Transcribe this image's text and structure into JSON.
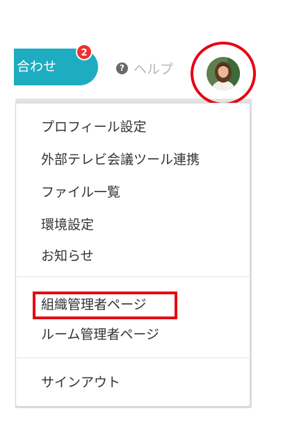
{
  "header": {
    "inquiry_label": "合わせ",
    "inquiry_badge_count": "2",
    "help_label": "ヘルプ",
    "help_icon": "question-circle-icon"
  },
  "user_menu": {
    "group1": [
      {
        "label": "プロフィール設定"
      },
      {
        "label": "外部テレビ会議ツール連携"
      },
      {
        "label": "ファイル一覧"
      },
      {
        "label": "環境設定"
      },
      {
        "label": "お知らせ"
      }
    ],
    "group2": [
      {
        "label": "組織管理者ページ"
      },
      {
        "label": "ルーム管理者ページ"
      }
    ],
    "group3": [
      {
        "label": "サインアウト"
      }
    ]
  },
  "colors": {
    "accent": "#1eadc0",
    "badge": "#e8332f",
    "annotation_red": "#e60012"
  }
}
